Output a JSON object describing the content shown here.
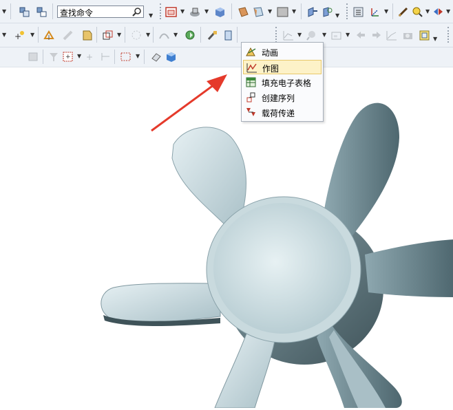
{
  "search": {
    "placeholder": "查找命令"
  },
  "plot_button": {
    "icon": "plot-icon"
  },
  "menu": {
    "items": [
      {
        "label": "动画",
        "icon": "animation-icon"
      },
      {
        "label": "作图",
        "icon": "plot-icon",
        "selected": true
      },
      {
        "label": "填充电子表格",
        "icon": "spreadsheet-icon"
      },
      {
        "label": "创建序列",
        "icon": "create-sequence-icon"
      },
      {
        "label": "载荷传递",
        "icon": "load-transfer-icon"
      }
    ]
  },
  "colors": {
    "accent": "#fdf0c2",
    "arrow": "#e53a2b",
    "model": "#b8cdd3"
  }
}
